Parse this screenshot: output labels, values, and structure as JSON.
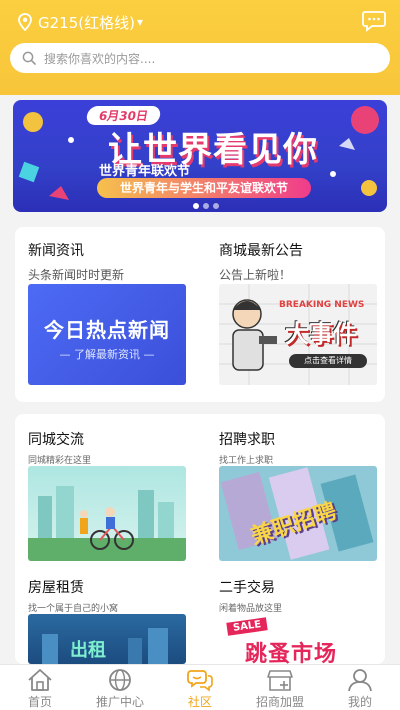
{
  "header": {
    "location": "G215(红格线)",
    "search_placeholder": "搜索你喜欢的内容....",
    "colors": {
      "bg": "#f8c53a"
    },
    "icons": {
      "location": "location-pin-icon",
      "message": "message-icon",
      "search": "search-icon"
    }
  },
  "banner": {
    "date": "6月30日",
    "title": "让世界看见你",
    "subtitle": "世界青年联欢节",
    "strip": "世界青年与学生和平友谊联欢节",
    "slides_total": 3,
    "active_slide": 1
  },
  "section1": {
    "news": {
      "title": "新闻资讯",
      "subtitle": "头条新闻时时更新",
      "img_big": "今日热点新闻",
      "img_small": "了解最新资讯"
    },
    "notice": {
      "title": "商城最新公告",
      "subtitle": "公告上新啦！",
      "img_head_a": "BREAKING",
      "img_head_b": "NEWS",
      "img_big": "大事件",
      "img_btn": "点击查看详情"
    }
  },
  "section2": {
    "city": {
      "title": "同城交流",
      "subtitle": "同城精彩在这里"
    },
    "jobs": {
      "title": "招聘求职",
      "subtitle": "找工作上求职",
      "img_text": "兼职招聘"
    },
    "rent": {
      "title": "房屋租赁",
      "subtitle": "找一个属于自己的小窝",
      "img_text": "出租"
    },
    "trade": {
      "title": "二手交易",
      "subtitle": "闲着物品放这里",
      "img_badge": "SALE",
      "img_text": "跳蚤市场"
    }
  },
  "tabbar": {
    "active_color": "#f0a51a",
    "items": [
      {
        "label": "首页",
        "icon": "home-icon"
      },
      {
        "label": "推广中心",
        "icon": "globe-icon"
      },
      {
        "label": "社区",
        "icon": "chat-bubbles-icon"
      },
      {
        "label": "招商加盟",
        "icon": "shop-icon"
      },
      {
        "label": "我的",
        "icon": "person-icon"
      }
    ],
    "active_index": 2
  }
}
